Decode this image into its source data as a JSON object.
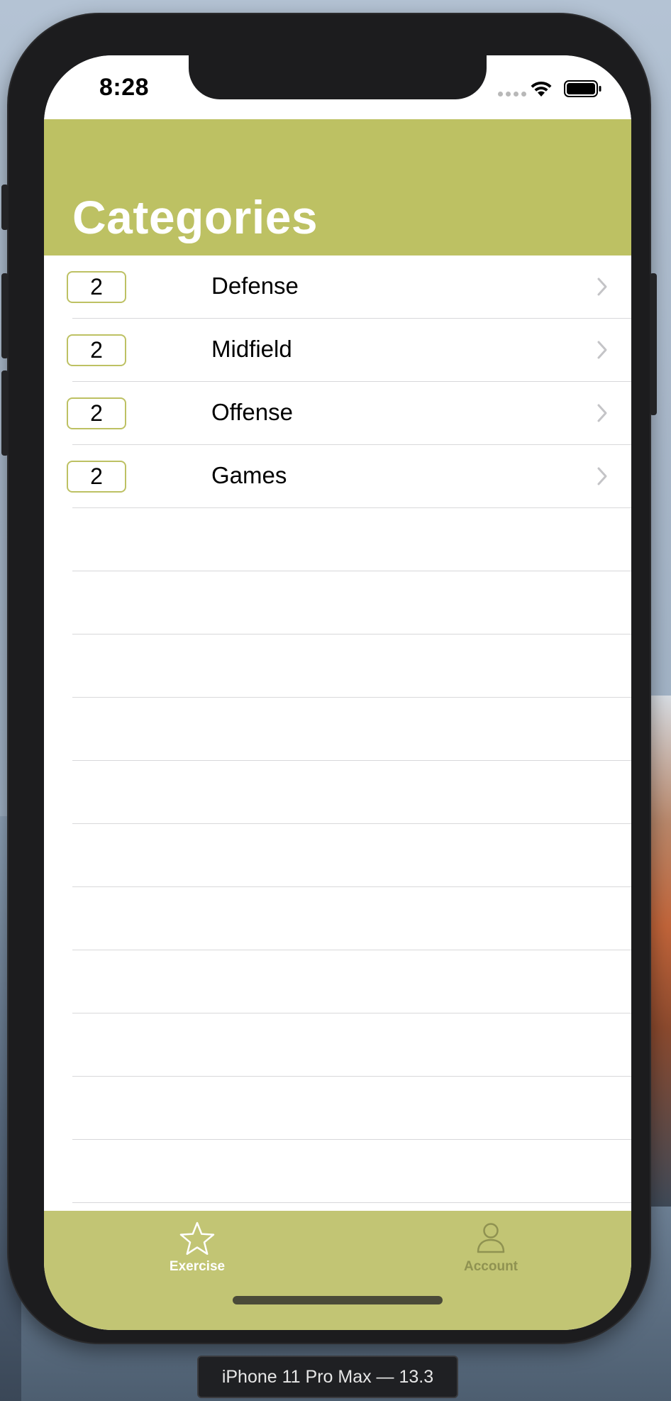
{
  "status_bar": {
    "time": "8:28",
    "icons": [
      "signal-dots-icon",
      "wifi-icon",
      "battery-icon"
    ]
  },
  "header": {
    "title": "Categories",
    "background_color": "#bdc163"
  },
  "categories": [
    {
      "count": "2",
      "label": "Defense"
    },
    {
      "count": "2",
      "label": "Midfield"
    },
    {
      "count": "2",
      "label": "Offense"
    },
    {
      "count": "2",
      "label": "Games"
    }
  ],
  "tab_bar": {
    "background_color": "#c2c574",
    "tabs": [
      {
        "label": "Exercise",
        "icon": "star-icon",
        "selected": true
      },
      {
        "label": "Account",
        "icon": "person-icon",
        "selected": false
      }
    ]
  },
  "simulator": {
    "device_label": "iPhone 11 Pro Max — 13.3"
  },
  "colors": {
    "accent": "#bdc163",
    "badge_border": "#bdc163"
  }
}
